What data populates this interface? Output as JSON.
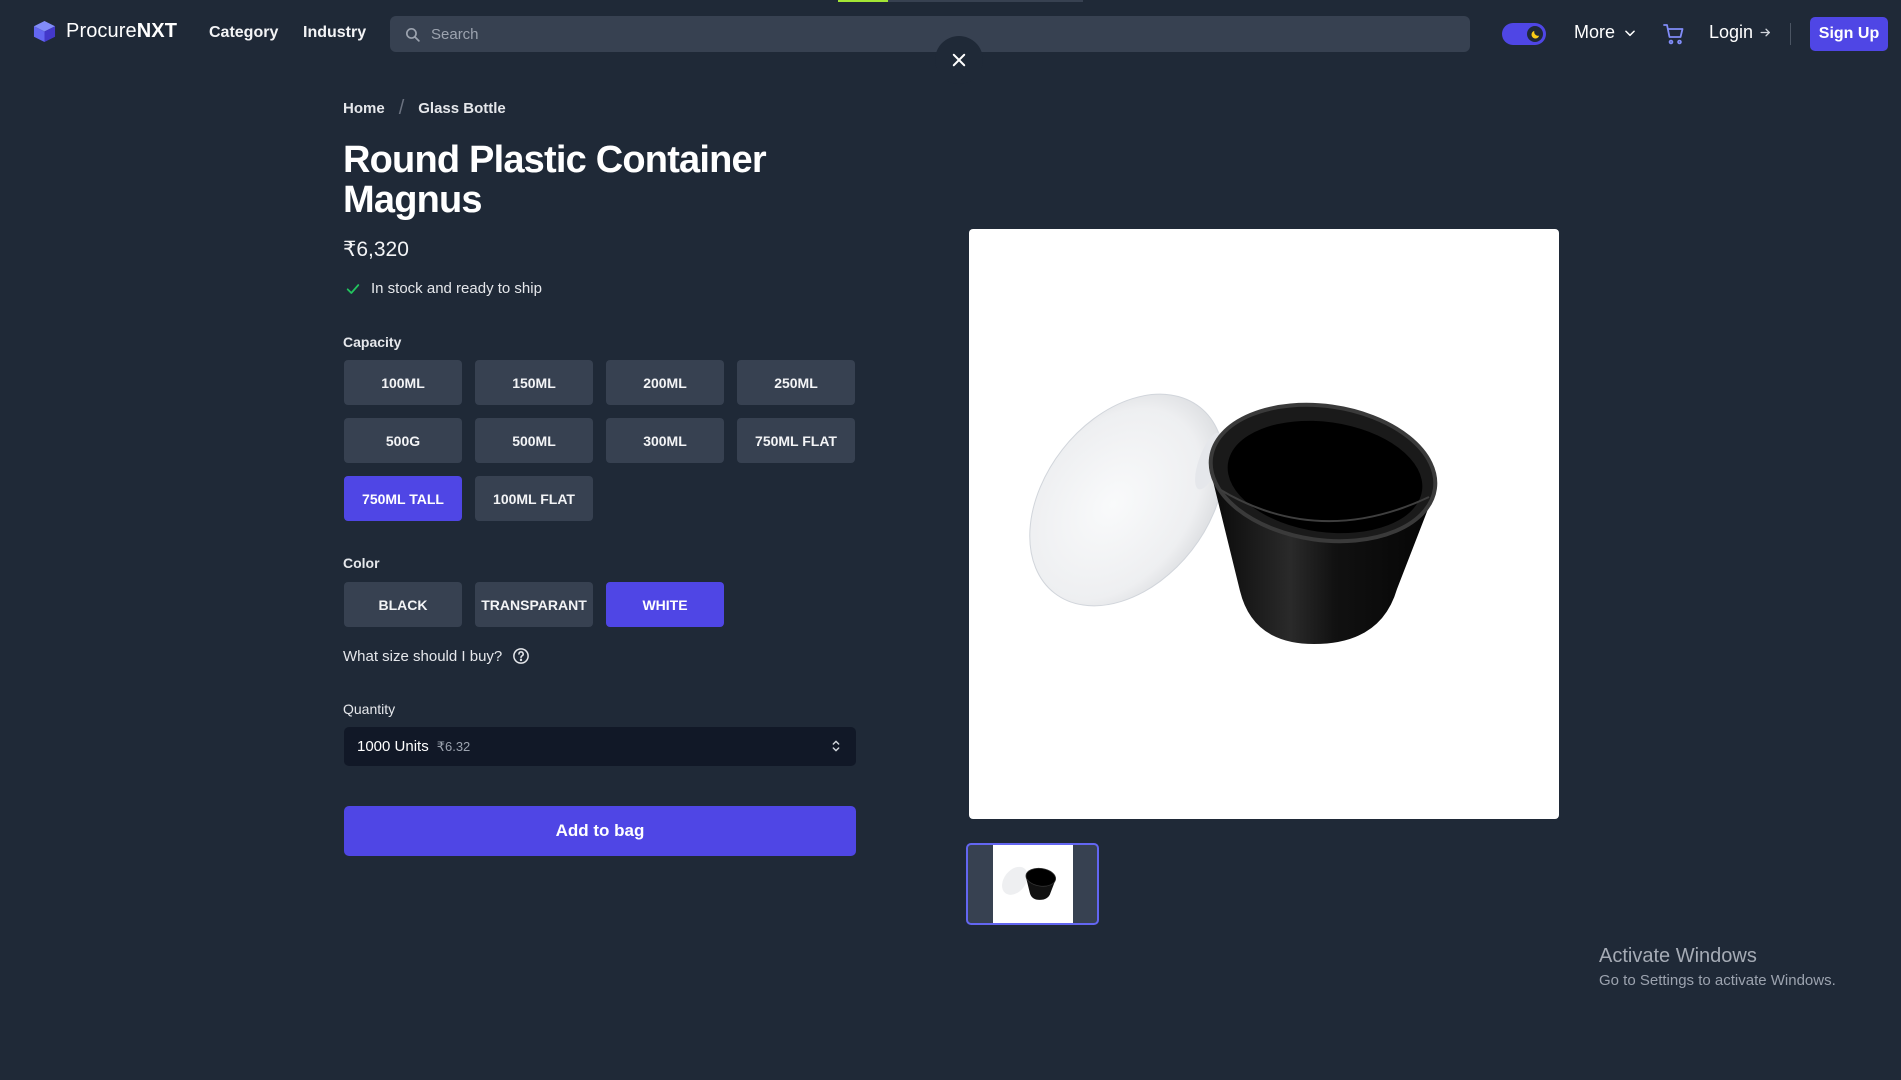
{
  "header": {
    "brand_prefix": "Procure",
    "brand_suffix": "NXT",
    "nav": [
      "Category",
      "Industry"
    ],
    "search_placeholder": "Search",
    "more_label": "More",
    "login_label": "Login",
    "signup_label": "Sign Up",
    "accent_color": "#4f46e5"
  },
  "breadcrumb": [
    "Home",
    "Glass Bottle"
  ],
  "product": {
    "title": "Round Plastic Container Magnus",
    "price": "₹6,320",
    "stock_status": "In stock and ready to ship",
    "capacity_label": "Capacity",
    "capacity_options": [
      "100ML",
      "150ML",
      "200ML",
      "250ML",
      "500G",
      "500ML",
      "300ML",
      "750ML FLAT",
      "750ML TALL",
      "100ML FLAT"
    ],
    "capacity_selected": "750ML TALL",
    "color_label": "Color",
    "color_options": [
      "BLACK",
      "TRANSPARANT",
      "WHITE"
    ],
    "color_selected": "WHITE",
    "size_help": "What size should I buy?",
    "quantity_label": "Quantity",
    "quantity_value": "1000 Units",
    "quantity_unit_price": "₹6.32",
    "add_to_bag": "Add to bag"
  },
  "icons": [
    "logo-cube-icon",
    "search-icon",
    "moon-icon",
    "chevron-down-icon",
    "cart-icon",
    "arrow-right-icon",
    "close-icon",
    "check-icon",
    "help-circle-icon",
    "chevron-updown-icon"
  ],
  "os_watermark": {
    "title": "Activate Windows",
    "subtitle": "Go to Settings to activate Windows."
  }
}
